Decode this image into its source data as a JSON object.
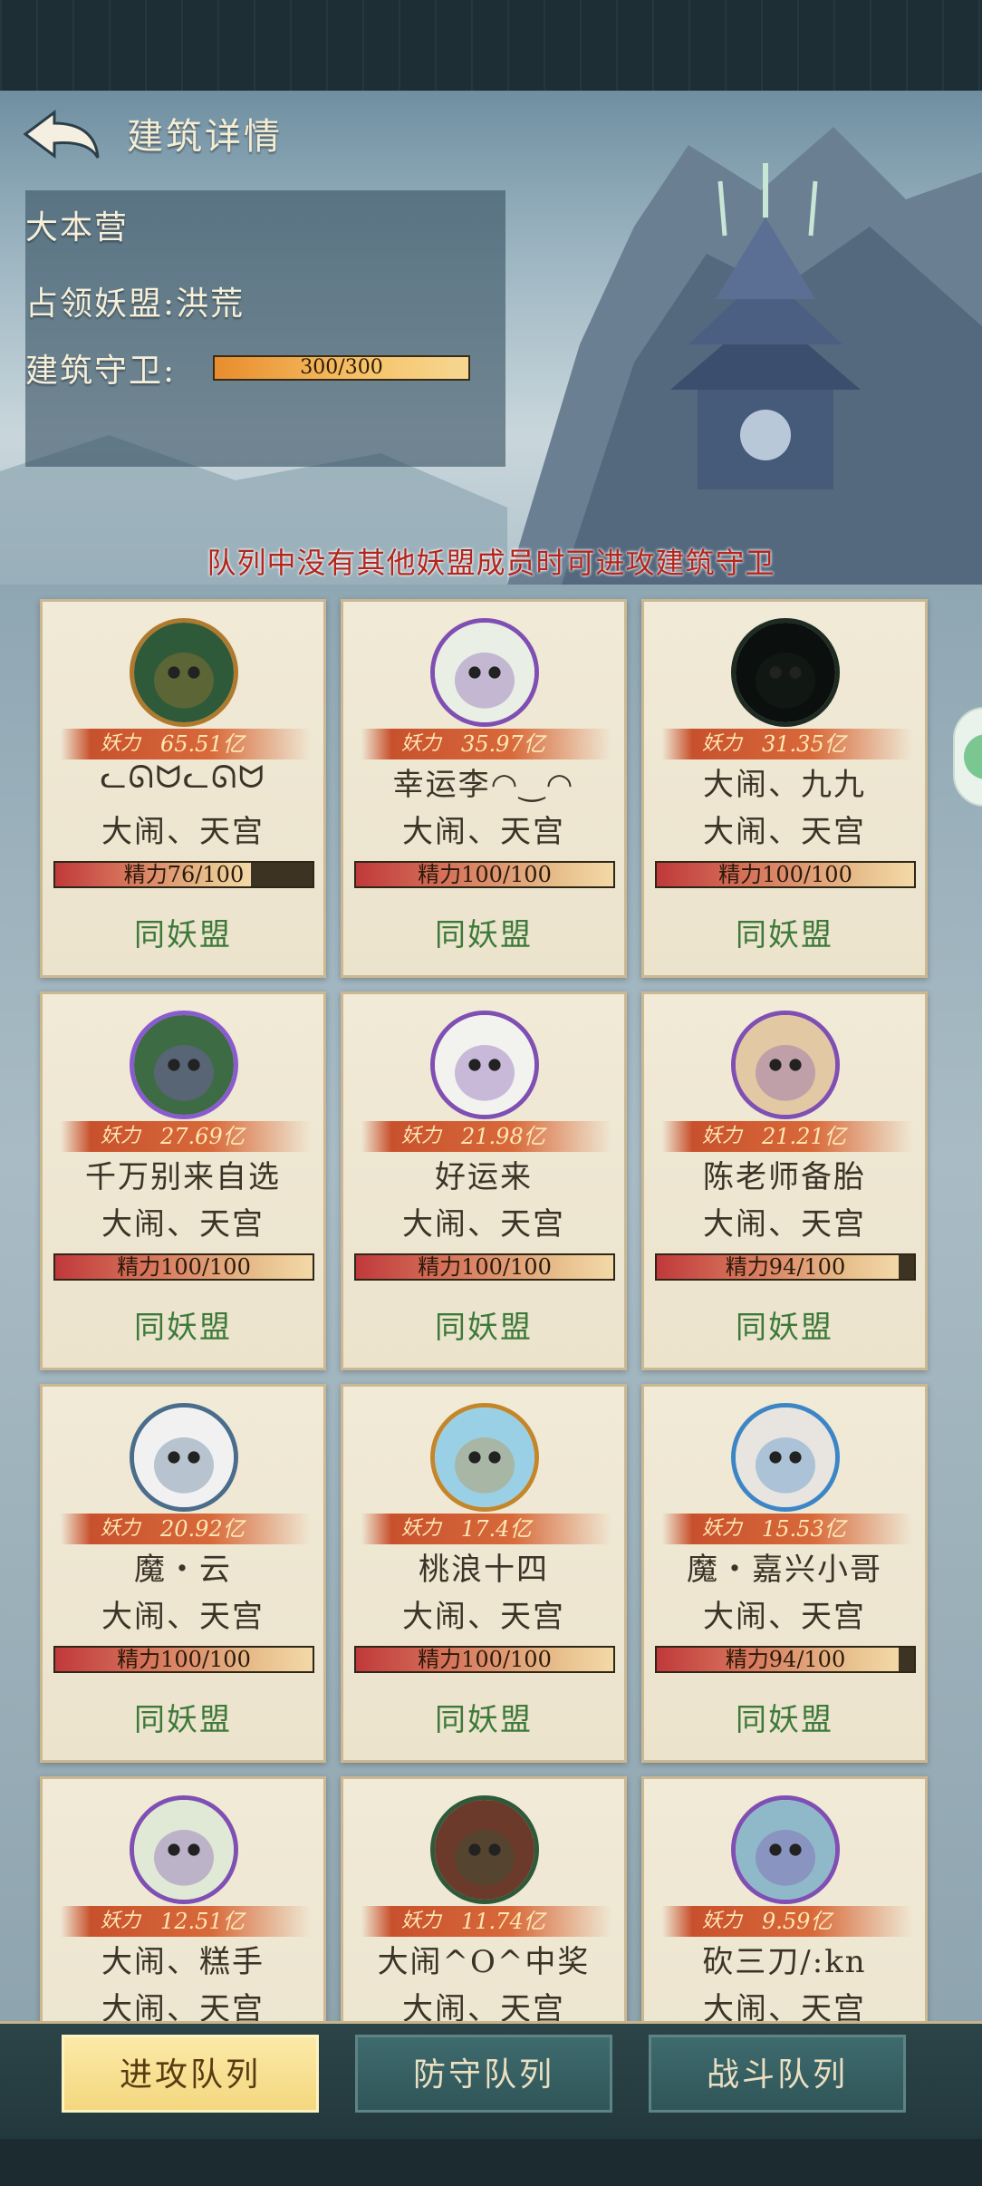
{
  "header": {
    "title": "建筑详情",
    "building_name": "大本营",
    "occupier_label": "占领妖盟:洪荒",
    "guard_label": "建筑守卫:",
    "guard_value": "300/300",
    "guard_fraction": 1.0,
    "notice": "队列中没有其他妖盟成员时可进攻建筑守卫"
  },
  "cards": [
    {
      "power_label": "妖力",
      "power": "65.51亿",
      "name": "ᓚᘏᗢᓚᘏᗢ",
      "alliance": "大闹、天宫",
      "energy": "精力76/100",
      "energy_fraction": 0.76,
      "status": "同妖盟",
      "avatar": "frog-gold-avatar"
    },
    {
      "power_label": "妖力",
      "power": "35.97亿",
      "name": "幸运李◠‿◠",
      "alliance": "大闹、天宫",
      "energy": "精力100/100",
      "energy_fraction": 1.0,
      "status": "同妖盟",
      "avatar": "cat-white-avatar"
    },
    {
      "power_label": "妖力",
      "power": "31.35亿",
      "name": "大闹、九九",
      "alliance": "大闹、天宫",
      "energy": "精力100/100",
      "energy_fraction": 1.0,
      "status": "同妖盟",
      "avatar": "dark-photo-avatar"
    },
    {
      "power_label": "妖力",
      "power": "27.69亿",
      "name": "千万别来自选",
      "alliance": "大闹、天宫",
      "energy": "精力100/100",
      "energy_fraction": 1.0,
      "status": "同妖盟",
      "avatar": "frog-purple-avatar"
    },
    {
      "power_label": "妖力",
      "power": "21.98亿",
      "name": "好运来",
      "alliance": "大闹、天宫",
      "energy": "精力100/100",
      "energy_fraction": 1.0,
      "status": "同妖盟",
      "avatar": "panda-avatar"
    },
    {
      "power_label": "妖力",
      "power": "21.21亿",
      "name": "陈老师备胎",
      "alliance": "大闹、天宫",
      "energy": "精力94/100",
      "energy_fraction": 0.94,
      "status": "同妖盟",
      "avatar": "scholar-avatar"
    },
    {
      "power_label": "妖力",
      "power": "20.92亿",
      "name": "魔・云",
      "alliance": "大闹、天宫",
      "energy": "精力100/100",
      "energy_fraction": 1.0,
      "status": "同妖盟",
      "avatar": "rabbit-avatar"
    },
    {
      "power_label": "妖力",
      "power": "17.4亿",
      "name": "桃浪十四",
      "alliance": "大闹、天宫",
      "energy": "精力100/100",
      "energy_fraction": 1.0,
      "status": "同妖盟",
      "avatar": "warrior-avatar"
    },
    {
      "power_label": "妖力",
      "power": "15.53亿",
      "name": "魔・嘉兴小哥",
      "alliance": "大闹、天宫",
      "energy": "精力94/100",
      "energy_fraction": 0.94,
      "status": "同妖盟",
      "avatar": "man-photo-avatar"
    },
    {
      "power_label": "妖力",
      "power": "12.51亿",
      "name": "大闹、糕手",
      "alliance": "大闹、天宫",
      "energy": "",
      "energy_fraction": 1.0,
      "status": "",
      "avatar": "cat-green-avatar"
    },
    {
      "power_label": "妖力",
      "power": "11.74亿",
      "name": "大闹^O^中奖",
      "alliance": "大闹、天宫",
      "energy": "",
      "energy_fraction": 1.0,
      "status": "",
      "avatar": "boar-avatar"
    },
    {
      "power_label": "妖力",
      "power": "9.59亿",
      "name": "砍三刀/:kn",
      "alliance": "大闹、天宫",
      "energy": "",
      "energy_fraction": 1.0,
      "status": "",
      "avatar": "zombie-avatar"
    }
  ],
  "tabs": [
    {
      "label": "进攻队列",
      "active": true
    },
    {
      "label": "防守队列",
      "active": false
    },
    {
      "label": "战斗队列",
      "active": false
    }
  ]
}
